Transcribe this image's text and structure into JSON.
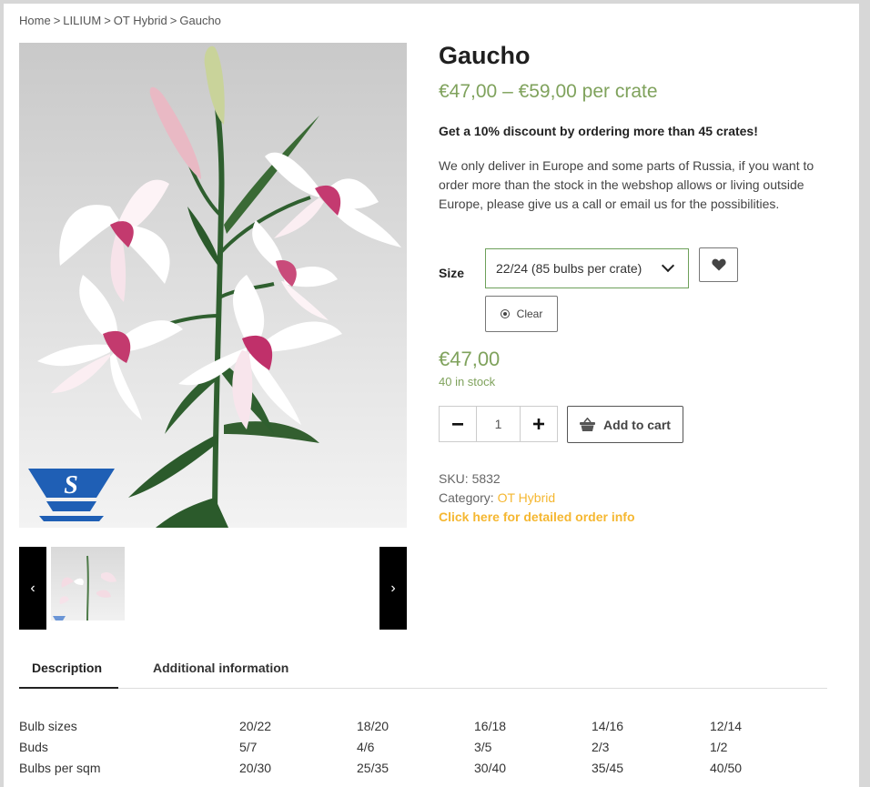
{
  "breadcrumb": [
    "Home",
    "LILIUM",
    "OT Hybrid",
    "Gaucho"
  ],
  "breadcrumb_separator": ">",
  "product": {
    "title": "Gaucho",
    "price_range": "€47,00 – €59,00 per crate",
    "promo": "Get a 10% discount by ordering more than 45 crates!",
    "notice": "We only deliver in Europe and some parts of Russia, if you want to order more than the stock in the webshop allows or living outside Europe, please give us a call or email us for the possibilities.",
    "size_label": "Size",
    "size_selected": "22/24 (85 bulbs per crate)",
    "clear_label": "Clear",
    "price": "€47,00",
    "stock": "40 in stock",
    "quantity": "1",
    "add_to_cart": "Add to cart",
    "sku_label": "SKU:",
    "sku": "5832",
    "category_label": "Category:",
    "category": "OT Hybrid",
    "order_info": "Click here for detailed order info"
  },
  "gallery": {
    "prev": "‹",
    "next": "›",
    "main_image": "pink-white-lily-flower-photo",
    "logo": "vs-logo"
  },
  "tabs": [
    {
      "label": "Description",
      "active": true
    },
    {
      "label": "Additional information",
      "active": false
    }
  ],
  "specs": [
    [
      "Bulb sizes",
      "20/22",
      "18/20",
      "16/18",
      "14/16",
      "12/14"
    ],
    [
      "Buds",
      "5/7",
      "4/6",
      "3/5",
      "2/3",
      "1/2"
    ],
    [
      "Bulbs per sqm",
      "20/30",
      "25/35",
      "30/40",
      "35/45",
      "40/50"
    ]
  ],
  "colors": {
    "price_green": "#7fa25c",
    "select_border": "#6da05a",
    "link_yellow": "#f5b731",
    "logo_blue": "#1f5fb5"
  },
  "icons": [
    "heart-icon",
    "clear-icon",
    "minus-icon",
    "plus-icon",
    "basket-icon",
    "chevron-down-icon",
    "chevron-left-icon",
    "chevron-right-icon"
  ]
}
